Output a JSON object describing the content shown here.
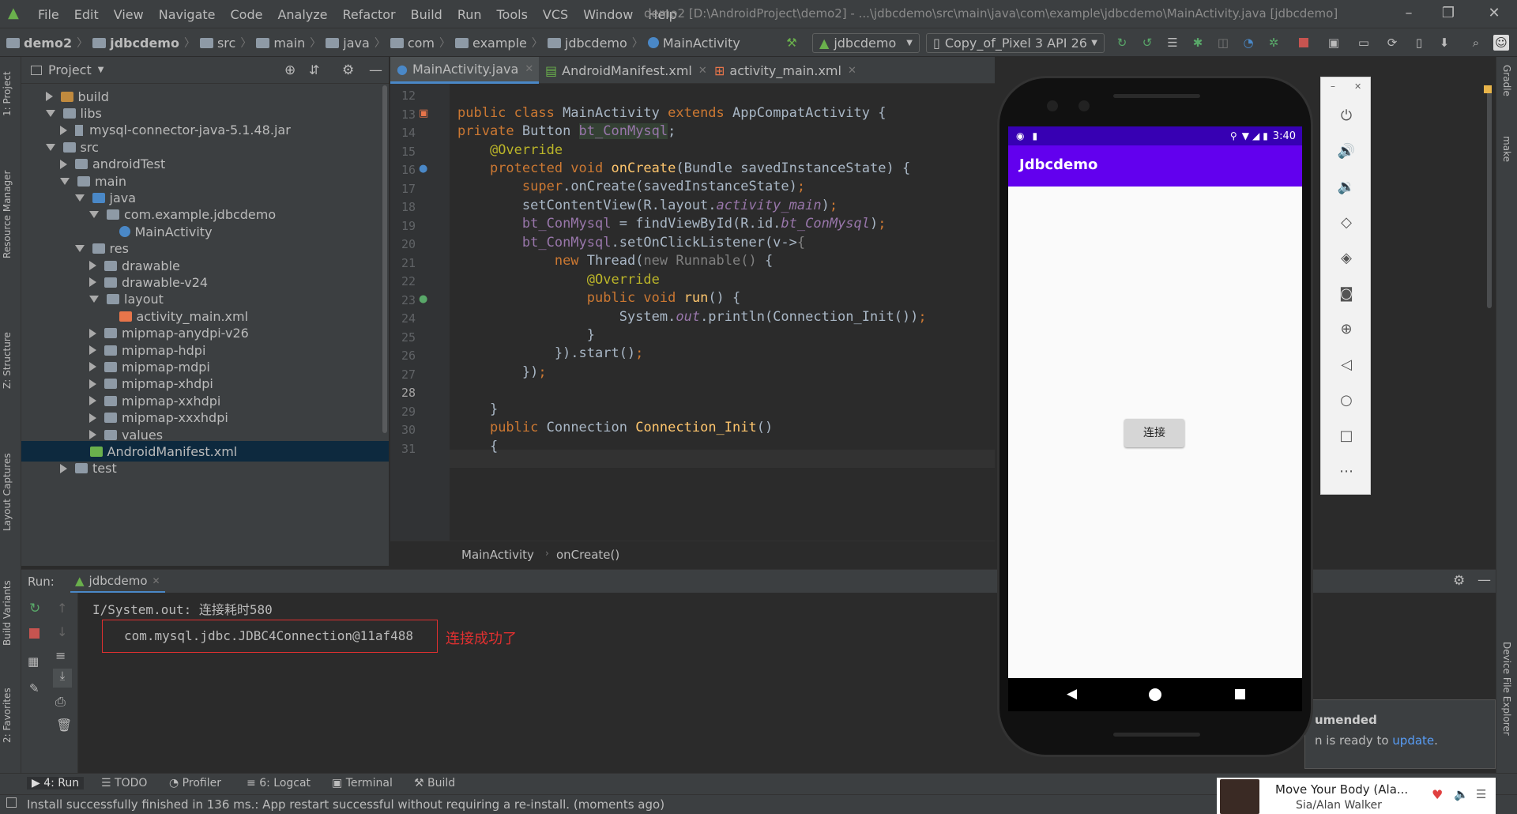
{
  "menu": {
    "items": [
      "File",
      "Edit",
      "View",
      "Navigate",
      "Code",
      "Analyze",
      "Refactor",
      "Build",
      "Run",
      "Tools",
      "VCS",
      "Window",
      "Help"
    ],
    "title": "demo2 [D:\\AndroidProject\\demo2] - ...\\jdbcdemo\\src\\main\\java\\com\\example\\jdbcdemo\\MainActivity.java [jdbcdemo]"
  },
  "nav": {
    "breadcrumbs": [
      "demo2",
      "jdbcdemo",
      "src",
      "main",
      "java",
      "com",
      "example",
      "jdbcdemo",
      "MainActivity"
    ],
    "run_config": "jdbcdemo",
    "device": "Copy_of_Pixel 3 API 26"
  },
  "project": {
    "header": "Project",
    "tree": [
      {
        "label": "build",
        "state": "r",
        "indent": 1,
        "icon": "folder-orange"
      },
      {
        "label": "libs",
        "state": "d",
        "indent": 1,
        "icon": "folder"
      },
      {
        "label": "mysql-connector-java-5.1.48.jar",
        "state": "r",
        "indent": 2,
        "icon": "jar"
      },
      {
        "label": "src",
        "state": "d",
        "indent": 1,
        "icon": "folder"
      },
      {
        "label": "androidTest",
        "state": "r",
        "indent": 2,
        "icon": "folder"
      },
      {
        "label": "main",
        "state": "d",
        "indent": 2,
        "icon": "folder"
      },
      {
        "label": "java",
        "state": "d",
        "indent": 3,
        "icon": "folder-blue"
      },
      {
        "label": "com.example.jdbcdemo",
        "state": "d",
        "indent": 4,
        "icon": "package"
      },
      {
        "label": "MainActivity",
        "state": "n",
        "indent": 5,
        "icon": "class"
      },
      {
        "label": "res",
        "state": "d",
        "indent": 3,
        "icon": "folder-res"
      },
      {
        "label": "drawable",
        "state": "r",
        "indent": 4,
        "icon": "package"
      },
      {
        "label": "drawable-v24",
        "state": "r",
        "indent": 4,
        "icon": "package"
      },
      {
        "label": "layout",
        "state": "d",
        "indent": 4,
        "icon": "package"
      },
      {
        "label": "activity_main.xml",
        "state": "n",
        "indent": 5,
        "icon": "xml"
      },
      {
        "label": "mipmap-anydpi-v26",
        "state": "r",
        "indent": 4,
        "icon": "package"
      },
      {
        "label": "mipmap-hdpi",
        "state": "r",
        "indent": 4,
        "icon": "package"
      },
      {
        "label": "mipmap-mdpi",
        "state": "r",
        "indent": 4,
        "icon": "package"
      },
      {
        "label": "mipmap-xhdpi",
        "state": "r",
        "indent": 4,
        "icon": "package"
      },
      {
        "label": "mipmap-xxhdpi",
        "state": "r",
        "indent": 4,
        "icon": "package"
      },
      {
        "label": "mipmap-xxxhdpi",
        "state": "r",
        "indent": 4,
        "icon": "package"
      },
      {
        "label": "values",
        "state": "r",
        "indent": 4,
        "icon": "package"
      },
      {
        "label": "AndroidManifest.xml",
        "state": "n",
        "indent": 3,
        "icon": "manifest",
        "selected": true
      },
      {
        "label": "test",
        "state": "r",
        "indent": 2,
        "icon": "folder"
      }
    ]
  },
  "left_tabs": [
    "1: Project",
    "Resource Manager",
    "Z: Structure",
    "Layout Captures",
    "Build Variants",
    "2: Favorites"
  ],
  "right_tabs": [
    "Gradle",
    "make",
    "Device File Explorer"
  ],
  "editor": {
    "tabs": [
      "MainActivity.java",
      "AndroidManifest.xml",
      "activity_main.xml"
    ],
    "line_numbers": [
      "12",
      "13",
      "14",
      "15",
      "16",
      "17",
      "18",
      "19",
      "20",
      "21",
      "22",
      "23",
      "24",
      "25",
      "26",
      "27",
      "28",
      "29",
      "30",
      "31"
    ],
    "breadcrumb": [
      "MainActivity",
      "onCreate()"
    ]
  },
  "run": {
    "label": "Run:",
    "tab": "jdbcdemo",
    "line1": "I/System.out: 连接耗时580",
    "line2": "com.mysql.jdbc.JDBC4Connection@11af488",
    "annotation": "连接成功了"
  },
  "bottom_tabs": [
    "4: Run",
    "TODO",
    "Profiler",
    "6: Logcat",
    "Terminal",
    "Build"
  ],
  "status": "Install successfully finished in 136 ms.: App restart successful without requiring a re-install. (moments ago)",
  "emulator": {
    "time": "3:40",
    "app_title": "Jdbcdemo",
    "button": "连接",
    "accent": "#6200ee"
  },
  "notification": {
    "title": "umended",
    "text_prefix": "n is ready to",
    "link": "update",
    "suffix": "."
  },
  "media": {
    "title": "Move Your Body (Ala...",
    "artist": "Sia/Alan Walker"
  }
}
